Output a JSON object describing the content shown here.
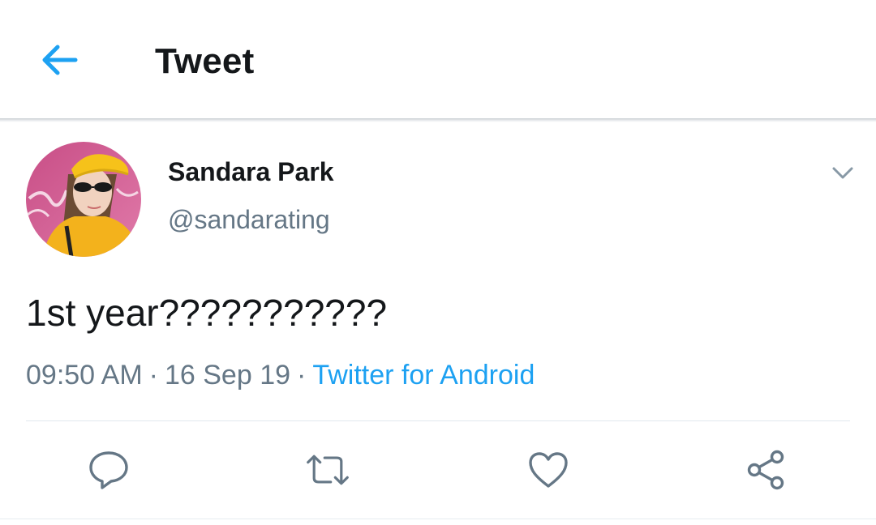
{
  "header": {
    "title": "Tweet",
    "back_icon": "arrow-left-icon"
  },
  "tweet": {
    "display_name": "Sandara Park",
    "handle": "@sandarating",
    "text": "1st year???????????",
    "time": "09:50 AM",
    "date": "16 Sep 19",
    "separator": "·",
    "source": "Twitter for Android",
    "menu_icon": "chevron-down-icon"
  },
  "actions": [
    {
      "icon": "reply-icon"
    },
    {
      "icon": "retweet-icon"
    },
    {
      "icon": "like-icon"
    },
    {
      "icon": "share-icon"
    }
  ],
  "colors": {
    "accent": "#1da1f2",
    "text_primary": "#14171a",
    "text_secondary": "#657786",
    "icon_gray": "#657786",
    "divider": "#e1e8ed"
  }
}
